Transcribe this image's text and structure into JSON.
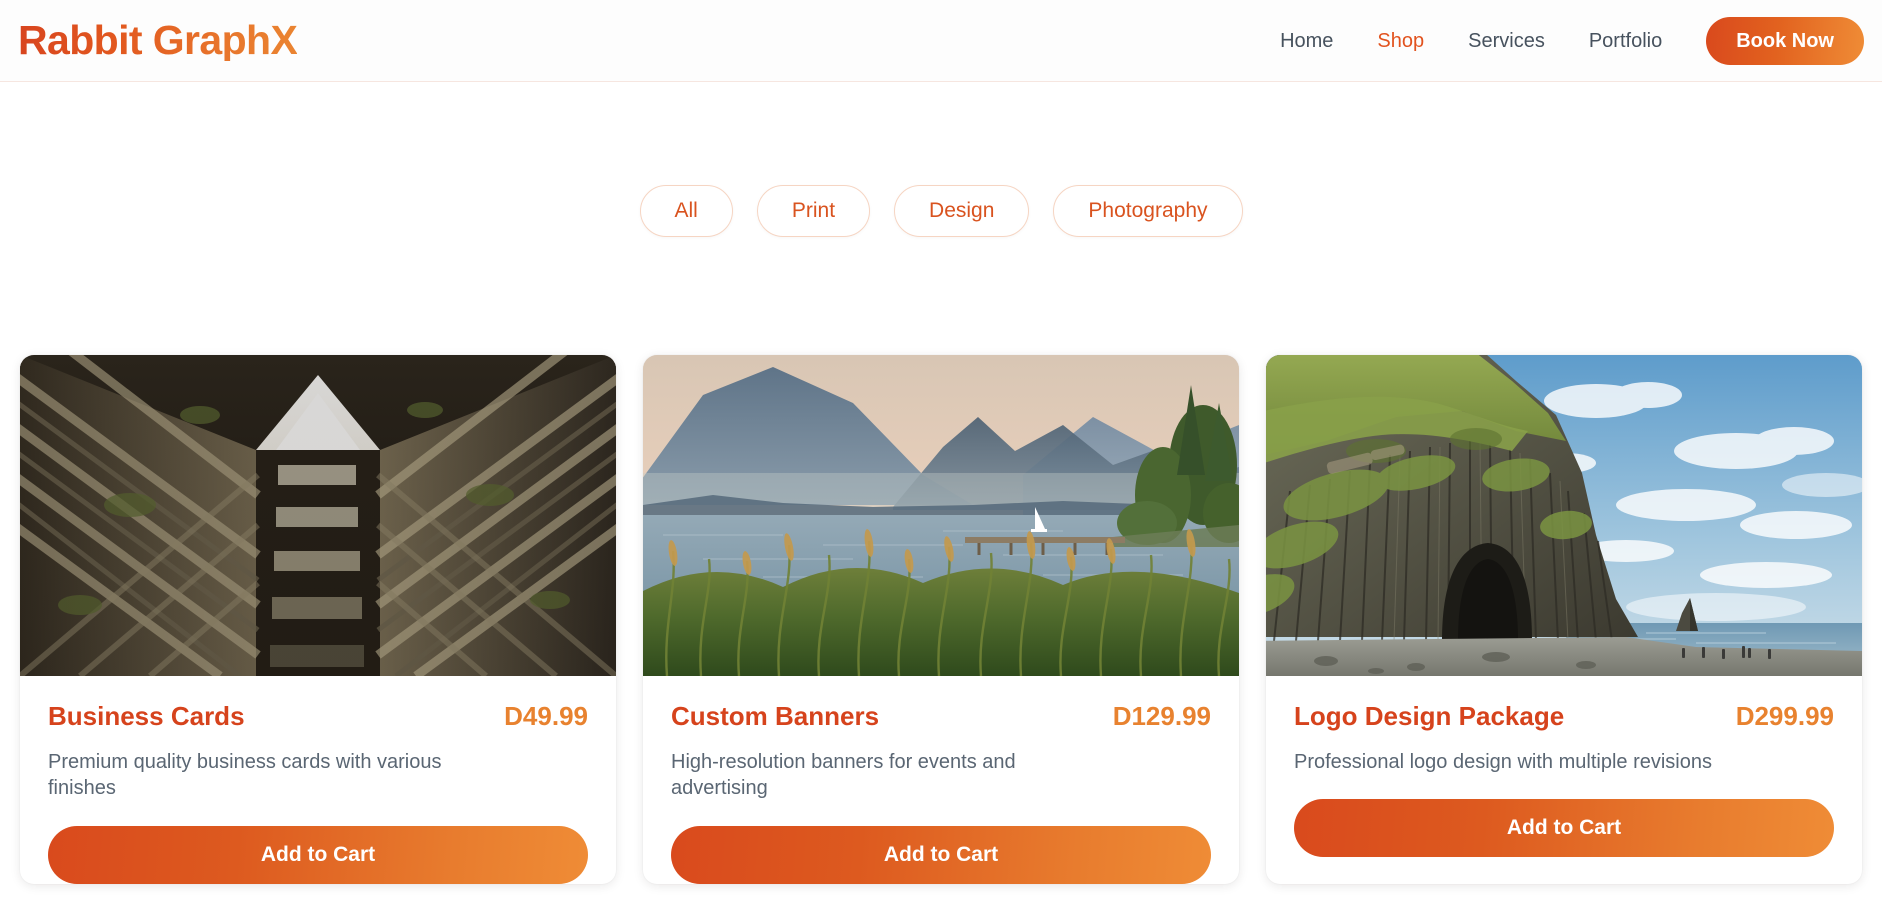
{
  "header": {
    "brand": "Rabbit GraphX",
    "nav": [
      {
        "label": "Home",
        "active": false
      },
      {
        "label": "Shop",
        "active": true
      },
      {
        "label": "Services",
        "active": false
      },
      {
        "label": "Portfolio",
        "active": false
      }
    ],
    "cta_label": "Book Now",
    "brand_gradient_from": "#d8451f",
    "brand_gradient_to": "#ea8431"
  },
  "filters": {
    "items": [
      {
        "label": "All"
      },
      {
        "label": "Print"
      },
      {
        "label": "Design"
      },
      {
        "label": "Photography"
      }
    ],
    "text_color": "#d9531f",
    "border_color": "#f6d5c3"
  },
  "products": [
    {
      "title": "Business Cards",
      "price": "D49.99",
      "description": "Premium quality business cards with various finishes",
      "button_label": "Add to Cart",
      "image_alt": "brutalist-concrete-towers-looking-up"
    },
    {
      "title": "Custom Banners",
      "price": "D129.99",
      "description": "High-resolution banners for events and advertising",
      "button_label": "Add to Cart",
      "image_alt": "lake-with-mountains-pier-and-tall-grass"
    },
    {
      "title": "Logo Design Package",
      "price": "D299.99",
      "description": "Professional logo design with multiple revisions",
      "button_label": "Add to Cart",
      "image_alt": "mossy-basalt-sea-cliff-with-black-beach"
    }
  ],
  "theme": {
    "accent": "#d6431c",
    "accent_light": "#e8822f",
    "text": "#47525e",
    "muted_text": "#5a6673",
    "page_bg": "#ffffff"
  }
}
